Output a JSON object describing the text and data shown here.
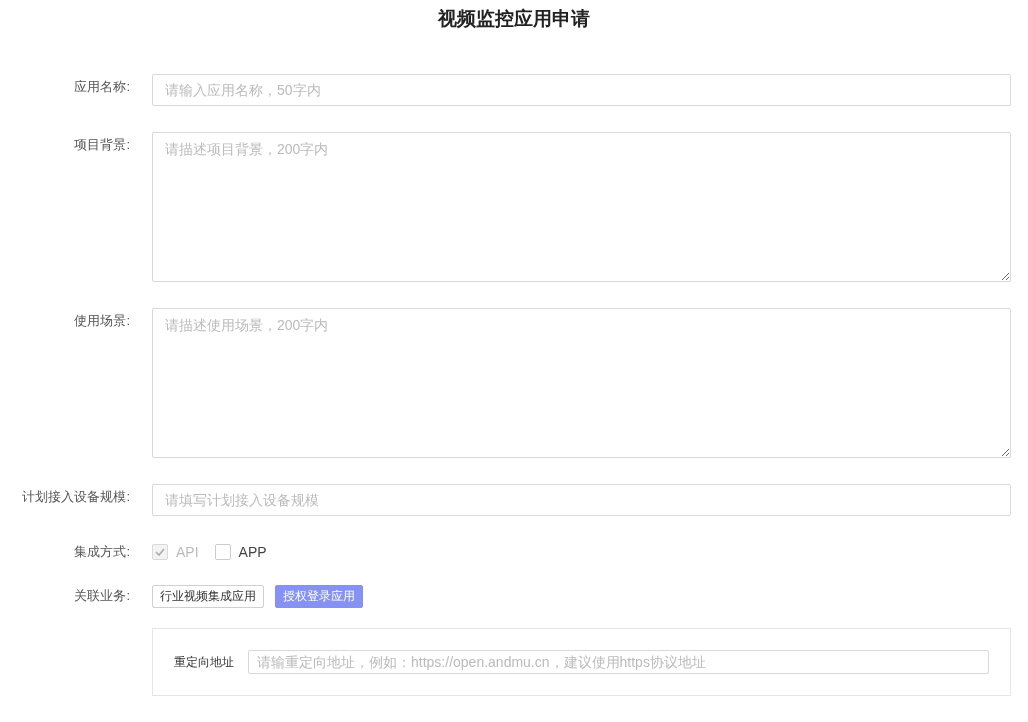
{
  "title": "视频监控应用申请",
  "fields": [
    {
      "label": "应用名称:",
      "kind": "input",
      "placeholder": "请输入应用名称，50字内"
    },
    {
      "label": "项目背景:",
      "kind": "textarea",
      "placeholder": "请描述项目背景，200字内"
    },
    {
      "label": "使用场景:",
      "kind": "textarea",
      "placeholder": "请描述使用场景，200字内"
    },
    {
      "label": "计划接入设备规模:",
      "kind": "input",
      "placeholder": "请填写计划接入设备规模"
    }
  ],
  "integration": {
    "label": "集成方式:",
    "options": [
      {
        "label": "API",
        "checked": true,
        "disabled": true
      },
      {
        "label": "APP",
        "checked": false,
        "disabled": false
      }
    ]
  },
  "business": {
    "label": "关联业务:",
    "tags": [
      {
        "label": "行业视频集成应用",
        "selected": false
      },
      {
        "label": "授权登录应用",
        "selected": true
      }
    ]
  },
  "redirect": {
    "label": "重定向地址",
    "placeholder": "请输重定向地址，例如：https://open.andmu.cn，建议使用https协议地址"
  }
}
